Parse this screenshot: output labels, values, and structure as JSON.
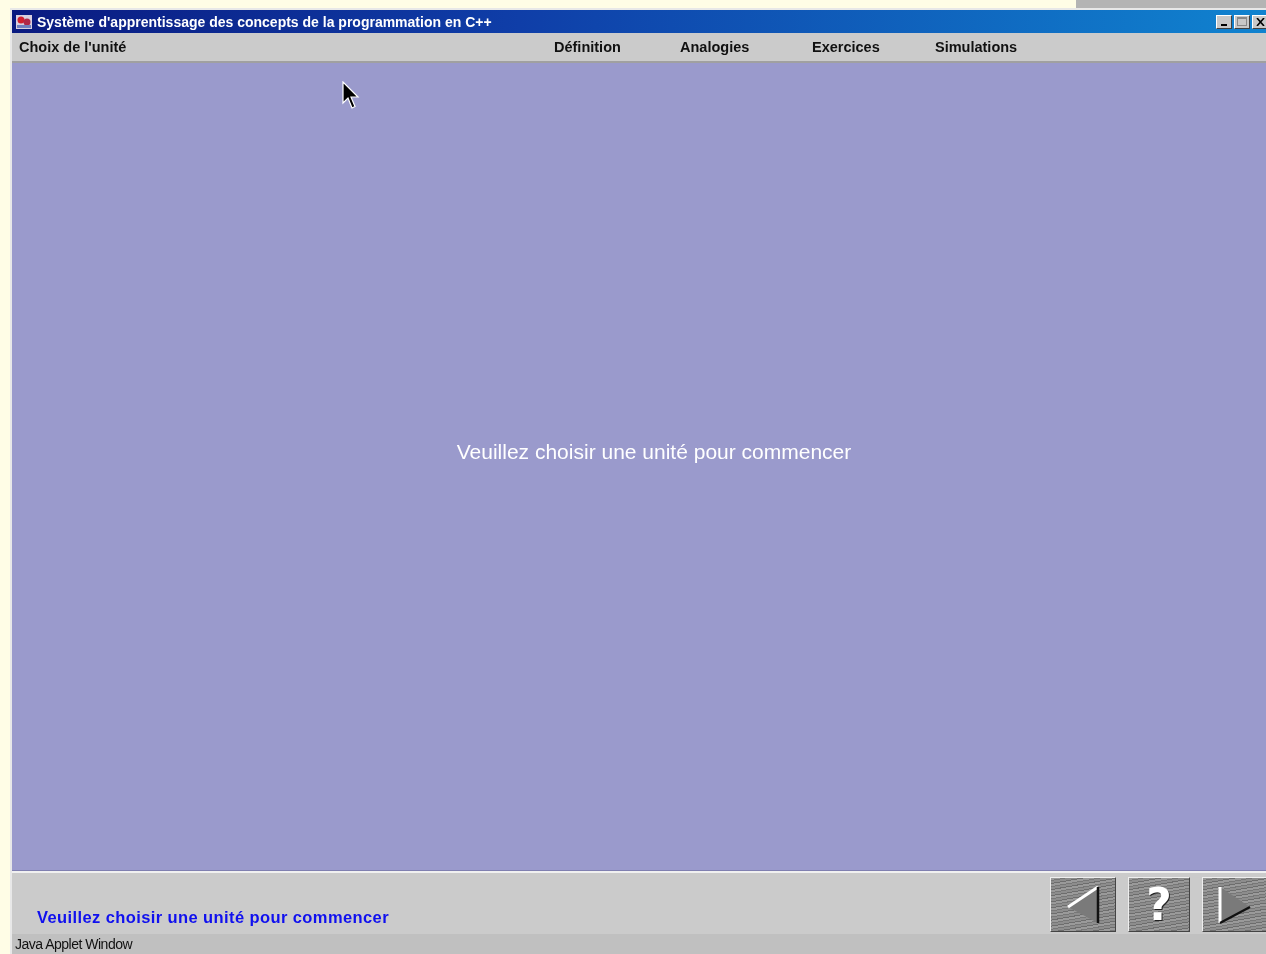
{
  "window": {
    "title": "Système d'apprentissage des concepts de la programmation en C++"
  },
  "menu": [
    {
      "label": "Choix de l'unité"
    },
    {
      "label": "Définition"
    },
    {
      "label": "Analogies"
    },
    {
      "label": "Exercices"
    },
    {
      "label": "Simulations"
    }
  ],
  "message": "Veuillez choisir une unité pour commencer",
  "status_message": "Veuillez choisir une unité pour commencer",
  "nav_buttons": [
    {
      "kind": "previous"
    },
    {
      "kind": "help",
      "label": "?"
    },
    {
      "kind": "next"
    }
  ],
  "applet_label": "Java Applet Window"
}
